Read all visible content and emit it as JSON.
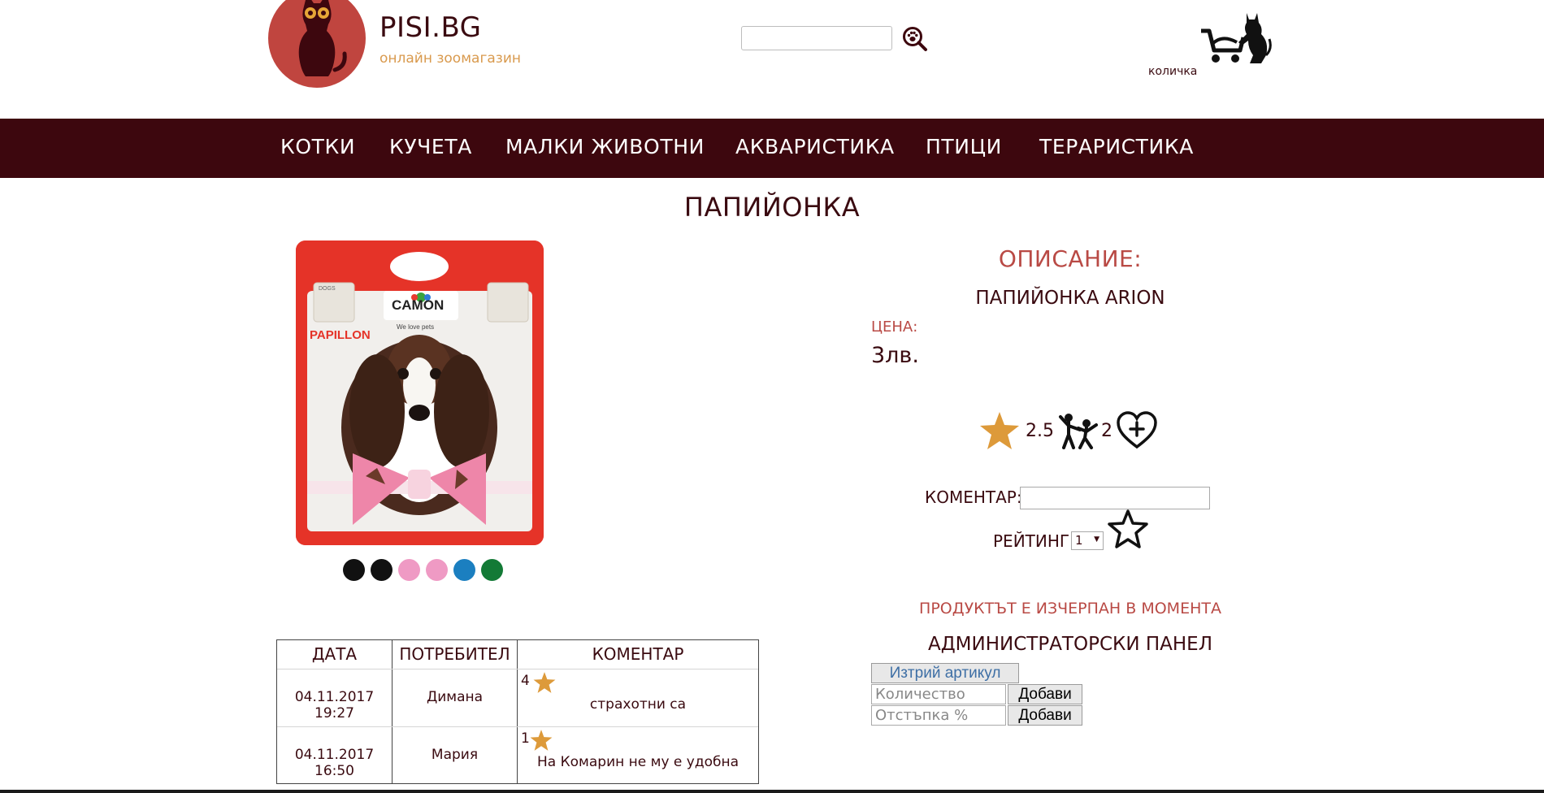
{
  "header": {
    "site_name": "PISI.BG",
    "tagline": "онлайн зоомагазин",
    "search_placeholder": "",
    "cart_label": "количка"
  },
  "nav": {
    "items": [
      "КОТКИ",
      "КУЧЕТА",
      "МАЛКИ ЖИВОТНИ",
      "АКВАРИСТИКА",
      "ПТИЦИ",
      "ТЕРАРИСТИКА"
    ]
  },
  "product": {
    "title": "ПАПИЙОНКА",
    "image_text": {
      "brand": "CAMON",
      "slogan": "We love pets",
      "name": "PAPILLON",
      "badge": "DOGS"
    },
    "colors": [
      "#111111",
      "#111111",
      "#ef9ac4",
      "#ef9ac4",
      "#1b7fc0",
      "#137a36"
    ],
    "description_heading": "ОПИСАНИЕ:",
    "description_name": "ПАПИЙОНКА ARION",
    "price_label": "ЦЕНА:",
    "price_value": "3лв.",
    "rating_value": "2.5",
    "raters_count": "2"
  },
  "comment_form": {
    "comment_label": "КОМЕНТАР:",
    "comment_value": "",
    "rating_label": "РЕЙТИНГ",
    "rating_selected": "1"
  },
  "stock_status": "ПРОДУКТЪТ Е ИЗЧЕРПАН В МОМЕНТА",
  "admin": {
    "heading": "АДМИНИСТРАТОРСКИ ПАНЕЛ",
    "delete_label": "Изтрий артикул",
    "quantity_placeholder": "Количество",
    "discount_placeholder": "Отстъпка %",
    "add_label": "Добави"
  },
  "comments_table": {
    "headers": [
      "ДАТА",
      "ПОТРЕБИТЕЛ",
      "КОМЕНТАР"
    ],
    "rows": [
      {
        "date": "04.11.2017 19:27",
        "user": "Димана",
        "rating": "4",
        "comment": "страхотни са"
      },
      {
        "date": "04.11.2017 16:50",
        "user": "Мария",
        "rating": "1",
        "comment": "На Комарин не му е удобна"
      }
    ]
  },
  "colors": {
    "brand_dark": "#3d070e",
    "accent_red": "#b94a45",
    "accent_orange": "#d99a4e",
    "star": "#dd9a3a"
  }
}
